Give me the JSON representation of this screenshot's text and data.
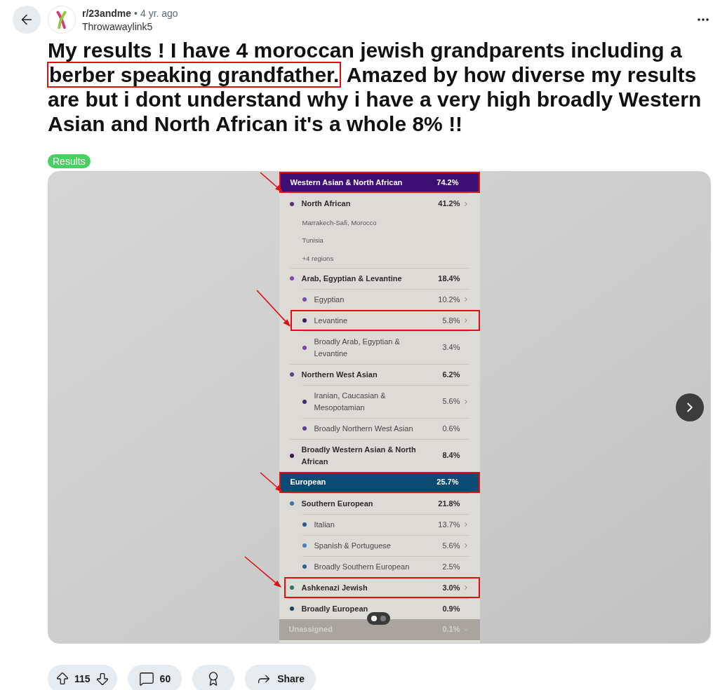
{
  "post": {
    "subreddit": "r/23andme",
    "separator": "•",
    "age": "4 yr. ago",
    "author": "Throwawaylink5"
  },
  "title": {
    "before": "My results ! I have 4 moroccan jewish grandparents including a",
    "highlighted": "berber speaking grandfather.",
    "after": "Amazed by how diverse my results are but i dont understand why i have a very high broadly Western Asian and North African it's a whole 8% !!"
  },
  "flair": "Results",
  "gallery": {
    "pages": [
      {
        "selected": true
      },
      {
        "selected": false
      }
    ],
    "sections": [
      {
        "label": "Western Asian & North African",
        "percent": "74.2%",
        "color": "#3c0d72",
        "annotated": true,
        "collapsed": false,
        "items": [
          {
            "kind": "region",
            "label": "North African",
            "percent": "41.2%",
            "color": "#52336f",
            "chevron": true,
            "annotated": false
          },
          {
            "kind": "location",
            "label": "Marrakech-Safi, Morocco"
          },
          {
            "kind": "location",
            "label": "Tunisia"
          },
          {
            "kind": "location",
            "label": "+4 regions"
          },
          {
            "kind": "region",
            "label": "Arab, Egyptian & Levantine",
            "percent": "18.4%",
            "color": "#7a4aad",
            "chevron": false,
            "annotated": false
          },
          {
            "kind": "subregion",
            "label": "Egyptian",
            "percent": "10.2%",
            "color": "#7a4aad",
            "chevron": true,
            "annotated": false
          },
          {
            "kind": "subregion",
            "label": "Levantine",
            "percent": "5.8%",
            "color": "#3a1c5c",
            "chevron": true,
            "annotated": true
          },
          {
            "kind": "subregion",
            "label": "Broadly Arab, Egyptian & Levantine",
            "percent": "3.4%",
            "color": "#7447a8",
            "chevron": false,
            "annotated": false
          },
          {
            "kind": "region",
            "label": "Northern West Asian",
            "percent": "6.2%",
            "color": "#5a3f8c",
            "chevron": false,
            "annotated": false
          },
          {
            "kind": "subregion",
            "label": "Iranian, Caucasian & Mesopotamian",
            "percent": "5.6%",
            "color": "#3e2a70",
            "chevron": true,
            "annotated": false
          },
          {
            "kind": "subregion",
            "label": "Broadly Northern West Asian",
            "percent": "0.6%",
            "color": "#5a3f8c",
            "chevron": false,
            "annotated": false
          },
          {
            "kind": "region",
            "label": "Broadly Western Asian & North African",
            "percent": "8.4%",
            "color": "#3a1858",
            "chevron": false,
            "annotated": false
          }
        ]
      },
      {
        "label": "European",
        "percent": "25.7%",
        "color": "#0b4a72",
        "annotated": true,
        "collapsed": false,
        "items": [
          {
            "kind": "region",
            "label": "Southern European",
            "percent": "21.8%",
            "color": "#3f70a8",
            "chevron": false,
            "annotated": false
          },
          {
            "kind": "subregion",
            "label": "Italian",
            "percent": "13.7%",
            "color": "#2a5a8c",
            "chevron": true,
            "annotated": false
          },
          {
            "kind": "subregion",
            "label": "Spanish & Portuguese",
            "percent": "5.6%",
            "color": "#4a80b6",
            "chevron": true,
            "annotated": false
          },
          {
            "kind": "subregion",
            "label": "Broadly Southern European",
            "percent": "2.5%",
            "color": "#2f5f95",
            "chevron": false,
            "annotated": false
          },
          {
            "kind": "region",
            "label": "Ashkenazi Jewish",
            "percent": "3.0%",
            "color": "#237a68",
            "chevron": true,
            "annotated": true
          },
          {
            "kind": "region",
            "label": "Broadly European",
            "percent": "0.9%",
            "color": "#17445f",
            "chevron": false,
            "annotated": false
          }
        ]
      },
      {
        "label": "Unassigned",
        "percent": "0.1%",
        "color": "#a9a49e",
        "annotated": false,
        "collapsed": true
      }
    ]
  },
  "actions": {
    "score": "115",
    "comments": "60",
    "share": "Share"
  }
}
